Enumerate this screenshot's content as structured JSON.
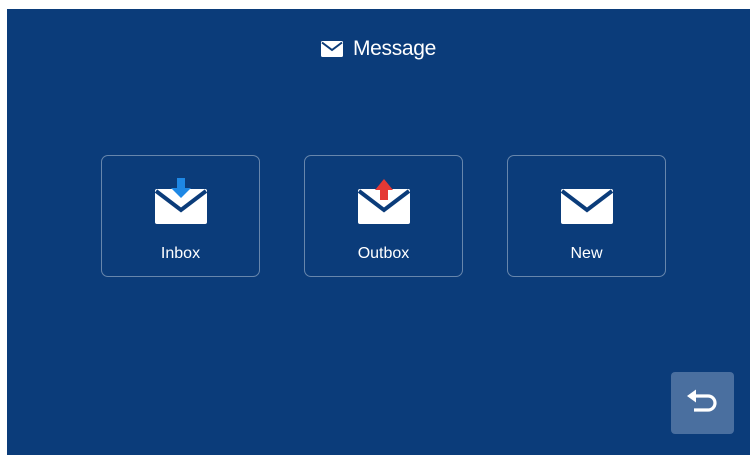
{
  "header": {
    "title": "Message",
    "icon": "envelope-icon"
  },
  "tiles": [
    {
      "label": "Inbox",
      "icon": "envelope-download-icon",
      "arrow_color": "#1e88e5"
    },
    {
      "label": "Outbox",
      "icon": "envelope-upload-icon",
      "arrow_color": "#e53935"
    },
    {
      "label": "New",
      "icon": "envelope-icon"
    }
  ],
  "back_button": {
    "icon": "return-arrow-icon"
  },
  "colors": {
    "background": "#0b3c7a",
    "back_button": "#4a6f9f",
    "text": "#ffffff"
  }
}
